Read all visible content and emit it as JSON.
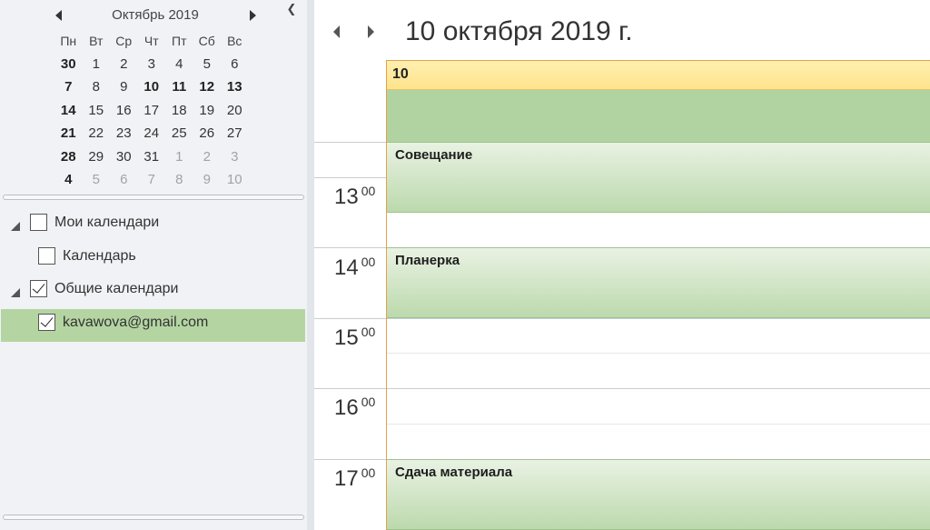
{
  "mini_calendar": {
    "month_title": "Октябрь 2019",
    "weekdays": [
      "Пн",
      "Вт",
      "Ср",
      "Чт",
      "Пт",
      "Сб",
      "Вс"
    ],
    "weeks": [
      [
        "30",
        "1",
        "2",
        "3",
        "4",
        "5",
        "6"
      ],
      [
        "7",
        "8",
        "9",
        "10",
        "11",
        "12",
        "13"
      ],
      [
        "14",
        "15",
        "16",
        "17",
        "18",
        "19",
        "20"
      ],
      [
        "21",
        "22",
        "23",
        "24",
        "25",
        "26",
        "27"
      ],
      [
        "28",
        "29",
        "30",
        "31",
        "1",
        "2",
        "3"
      ],
      [
        "4",
        "5",
        "6",
        "7",
        "8",
        "9",
        "10"
      ]
    ],
    "selected_day": "10"
  },
  "calendar_tree": {
    "my_calendars": {
      "label": "Мои календари",
      "checked": false
    },
    "calendar": {
      "label": "Календарь",
      "checked": false
    },
    "shared_calendars": {
      "label": "Общие календари",
      "checked": true
    },
    "shared_account": {
      "label": "kavawova@gmail.com",
      "checked": true
    }
  },
  "day_view": {
    "date_title": "10 октября 2019 г.",
    "day_number": "10",
    "hours": [
      {
        "hour": "13",
        "minutes": "00"
      },
      {
        "hour": "14",
        "minutes": "00"
      },
      {
        "hour": "15",
        "minutes": "00"
      },
      {
        "hour": "16",
        "minutes": "00"
      },
      {
        "hour": "17",
        "minutes": "00"
      }
    ],
    "events": [
      {
        "title": "Совещание"
      },
      {
        "title": "Планерка"
      },
      {
        "title": "Сдача материала"
      }
    ]
  },
  "colors": {
    "event_green": "#b4d5a2",
    "today_header": "#fde38c",
    "today_border": "#e4a14a"
  }
}
